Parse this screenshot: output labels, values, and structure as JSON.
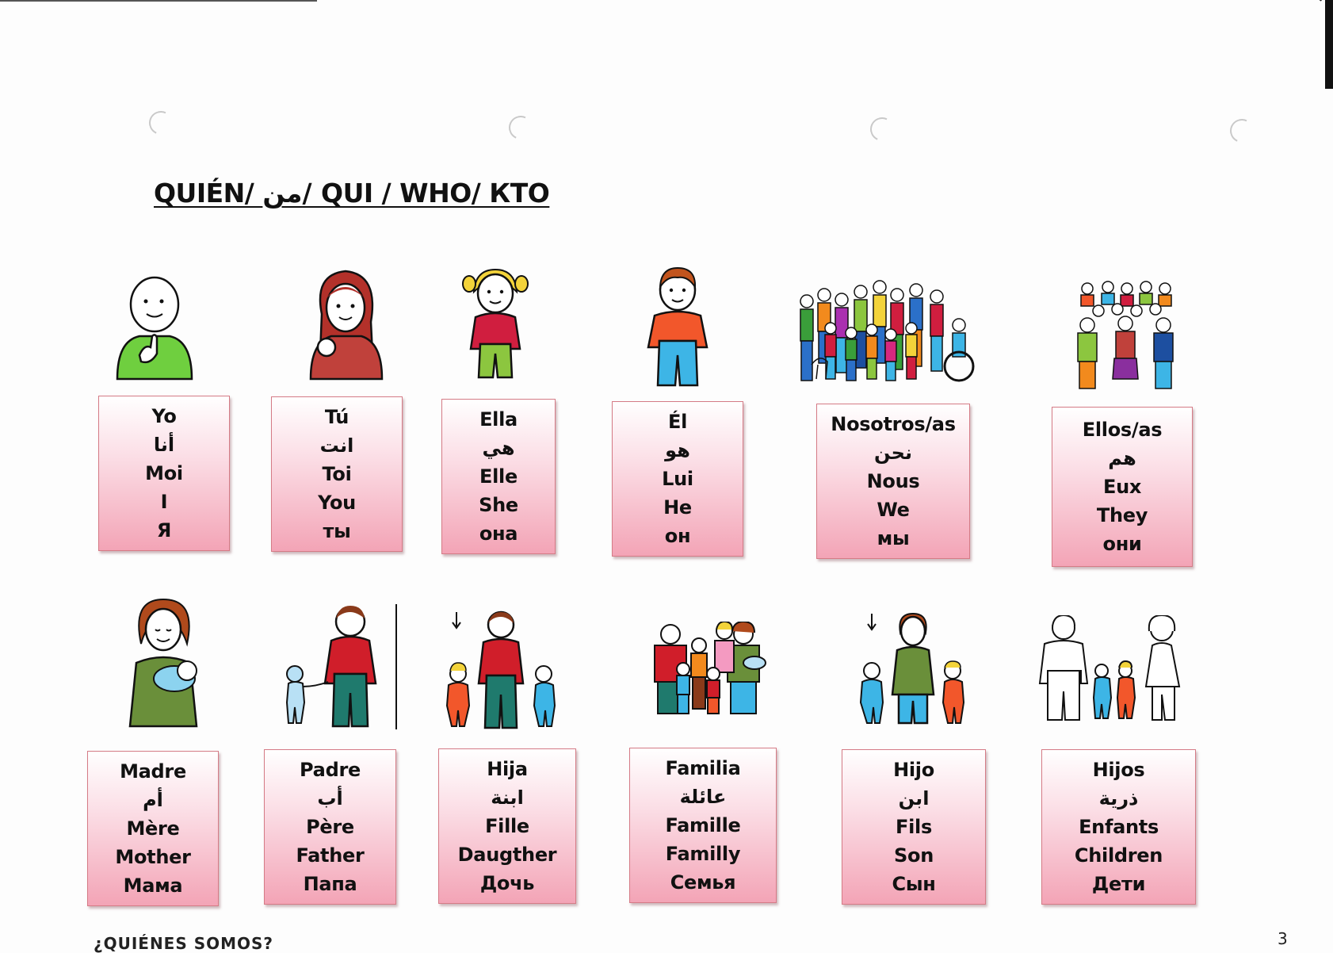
{
  "title": "QUIÉN/ من/ QUI / WHO/ КТО",
  "footer_text": "¿QUIÉNES SOMOS?",
  "page_number": "3",
  "cards_row1": [
    {
      "lines": [
        "Yo",
        "أنا",
        "Moi",
        "I",
        "Я"
      ],
      "icon": "me-pointing-self-icon"
    },
    {
      "lines": [
        "Tú",
        "انت",
        "Toi",
        "You",
        "ты"
      ],
      "icon": "you-pointing-icon"
    },
    {
      "lines": [
        "Ella",
        "هي",
        "Elle",
        "She",
        "она"
      ],
      "icon": "girl-icon"
    },
    {
      "lines": [
        "Él",
        "هو",
        "Lui",
        "He",
        "он"
      ],
      "icon": "boy-icon"
    },
    {
      "lines": [
        "Nosotros/as",
        "نحن",
        "Nous",
        "We",
        "мы"
      ],
      "icon": "crowd-we-icon"
    },
    {
      "lines": [
        "Ellos/as",
        "هم",
        "Eux",
        "They",
        "они"
      ],
      "icon": "group-they-icon"
    }
  ],
  "cards_row2": [
    {
      "lines": [
        "Madre",
        "أم",
        "Mère",
        "Mother",
        "Мама"
      ],
      "icon": "mother-baby-icon"
    },
    {
      "lines": [
        "Padre",
        "أب",
        "Père",
        "Father",
        "Папа"
      ],
      "icon": "father-child-icon"
    },
    {
      "lines": [
        "Hija",
        "ابنة",
        "Fille",
        "Daugther",
        "Дочь"
      ],
      "icon": "father-daughter-icon"
    },
    {
      "lines": [
        "Familia",
        "عائلة",
        "Famille",
        "Familly",
        "Семья"
      ],
      "icon": "family-icon"
    },
    {
      "lines": [
        "Hijo",
        "ابن",
        "Fils",
        "Son",
        "Сын"
      ],
      "icon": "mother-son-icon"
    },
    {
      "lines": [
        "Hijos",
        "ذرية",
        "Enfants",
        "Children",
        "Дети"
      ],
      "icon": "parents-children-icon"
    }
  ]
}
